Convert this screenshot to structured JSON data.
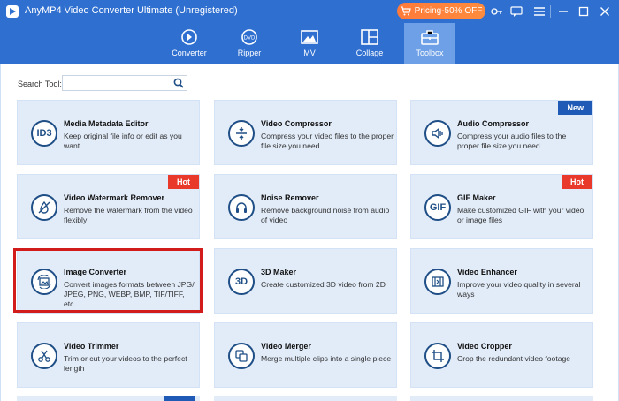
{
  "app": {
    "title": "AnyMP4 Video Converter Ultimate (Unregistered)",
    "pricing_label": "Pricing-50% OFF"
  },
  "nav": {
    "tabs": [
      {
        "label": "Converter",
        "icon": "converter-icon"
      },
      {
        "label": "Ripper",
        "icon": "ripper-icon"
      },
      {
        "label": "MV",
        "icon": "mv-icon"
      },
      {
        "label": "Collage",
        "icon": "collage-icon"
      },
      {
        "label": "Toolbox",
        "icon": "toolbox-icon",
        "active": true
      }
    ]
  },
  "search": {
    "label": "Search Tool:",
    "value": ""
  },
  "tools": [
    {
      "title": "Media Metadata Editor",
      "desc": "Keep original file info or edit as you want",
      "icon_text": "ID3",
      "badge": ""
    },
    {
      "title": "Video Compressor",
      "desc": "Compress your video files to the proper file size you need",
      "icon_text": "",
      "badge": ""
    },
    {
      "title": "Audio Compressor",
      "desc": "Compress your audio files to the proper file size you need",
      "icon_text": "",
      "badge": "New"
    },
    {
      "title": "Video Watermark Remover",
      "desc": "Remove the watermark from the video flexibly",
      "icon_text": "",
      "badge": "Hot"
    },
    {
      "title": "Noise Remover",
      "desc": "Remove background noise from audio of video",
      "icon_text": "",
      "badge": ""
    },
    {
      "title": "GIF Maker",
      "desc": "Make customized GIF with your video or image files",
      "icon_text": "GIF",
      "badge": "Hot"
    },
    {
      "title": "Image Converter",
      "desc": "Convert images formats between JPG/ JPEG, PNG, WEBP, BMP, TIF/TIFF, etc.",
      "icon_text": "",
      "badge": ""
    },
    {
      "title": "3D Maker",
      "desc": "Create customized 3D video from 2D",
      "icon_text": "3D",
      "badge": ""
    },
    {
      "title": "Video Enhancer",
      "desc": "Improve your video quality in several ways",
      "icon_text": "",
      "badge": ""
    },
    {
      "title": "Video Trimmer",
      "desc": "Trim or cut your videos to the perfect length",
      "icon_text": "",
      "badge": ""
    },
    {
      "title": "Video Merger",
      "desc": "Merge multiple clips into a single piece",
      "icon_text": "",
      "badge": ""
    },
    {
      "title": "Video Cropper",
      "desc": "Crop the redundant video footage",
      "icon_text": "",
      "badge": ""
    }
  ],
  "colors": {
    "accent": "#2f6fd0",
    "card_bg": "#e2ecf9",
    "highlight": "#d21c1c",
    "hot": "#e8392b",
    "new": "#1f5bb6"
  }
}
